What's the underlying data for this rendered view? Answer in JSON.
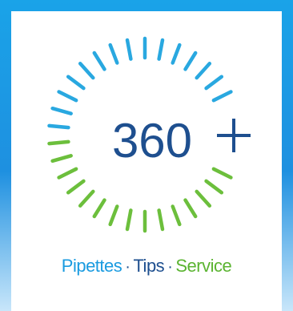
{
  "logo": {
    "number": "360",
    "plus": "+"
  },
  "tagline": {
    "pipettes": "Pipettes",
    "tips": "Tips",
    "service": "Service",
    "separator": "·"
  },
  "colors": {
    "frame_blue": "#1aa3e8",
    "ray_blue": "#29a8e0",
    "ray_green": "#6cbf3c",
    "navy": "#1e4f8f",
    "tagline_blue": "#1a9be0",
    "tagline_green": "#5bb431"
  }
}
